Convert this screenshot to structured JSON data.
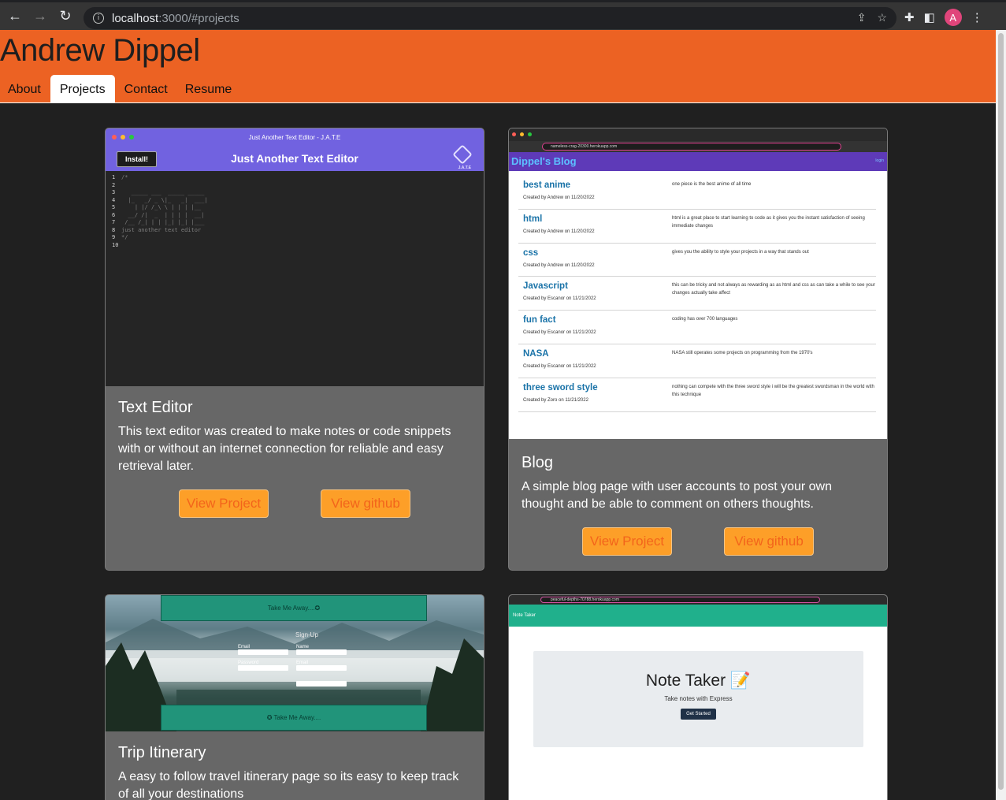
{
  "browser": {
    "url_host": "localhost",
    "url_path": ":3000/#projects",
    "profile_initial": "A"
  },
  "site": {
    "name": "Andrew Dippel",
    "tabs": [
      {
        "label": "About"
      },
      {
        "label": "Projects"
      },
      {
        "label": "Contact"
      },
      {
        "label": "Resume"
      }
    ],
    "active_tab": "Projects"
  },
  "projects": [
    {
      "title": "Text Editor",
      "description": "This text editor was created to make notes or code snippets with or without an internet connection for reliable and easy retrieval later.",
      "view_project": "View Project",
      "view_github": "View github",
      "thumb": {
        "window_title": "Just Another Text Editor - J.A.T.E",
        "app_title": "Just Another Text Editor",
        "install": "Install!",
        "logo_text": "J.A.T.E",
        "gutter": [
          "1",
          "2",
          "3",
          "4",
          "5",
          "6",
          "7",
          "8",
          "9",
          "10"
        ],
        "code": "/*\n\n   _____ ___  _____ _____\n  |_   _/ _ \\|_   _|  ___|\n    | |/ /_\\ \\ | | | |__\n  __/ /|  _  | | | |  __|\n /__ /_| | | |_| |_| |___\njust another text editor\n*/"
      }
    },
    {
      "title": "Blog",
      "description": "A simple blog page with user accounts to post your own thought and be able to comment on others thoughts.",
      "view_project": "View Project",
      "view_github": "View github",
      "thumb": {
        "address": "nameless-crag-20300.herokuapp.com",
        "blog_title": "Dippel's Blog",
        "login": "login",
        "posts": [
          {
            "title": "best anime",
            "meta": "Created by Andrew on 11/20/2022",
            "body": "one piece is the best anime of all time"
          },
          {
            "title": "html",
            "meta": "Created by Andrew on 11/20/2022",
            "body": "html is a great place to start learning to code as it gives you the instant satisfaction of seeing immediate changes"
          },
          {
            "title": "css",
            "meta": "Created by Andrew on 11/20/2022",
            "body": "gives you the ability to style your projects in a way that stands out"
          },
          {
            "title": "Javascript",
            "meta": "Created by Escanor on 11/21/2022",
            "body": "this can be tricky and not always as rewarding as as html and css as can take a while to see your changes actually take affect"
          },
          {
            "title": "fun fact",
            "meta": "Created by Escanor on 11/21/2022",
            "body": "coding has over 700 languages"
          },
          {
            "title": "NASA",
            "meta": "Created by Escanor on 11/21/2022",
            "body": "NASA still operates some projects on programming from the 1970's"
          },
          {
            "title": "three sword style",
            "meta": "Created by Zoro on 11/21/2022",
            "body": "nothing can compete with the three sword style i will be the greatest swordsman in the world with this technique"
          }
        ]
      }
    },
    {
      "title": "Trip Itinerary",
      "description": "A easy to follow travel itinerary page so its easy to keep track of all your destinations",
      "thumb": {
        "top_band": "Take Me Away....✪",
        "bottom_band": "✪ Take Me Away....",
        "form_title": "Sign-Up",
        "labels": [
          "Email",
          "Name",
          "Password",
          "Email"
        ]
      }
    },
    {
      "thumb": {
        "address": "peaceful-depths-70788.herokuapp.com",
        "nav": "Note Taker",
        "heading": "Note Taker 📝",
        "sub": "Take notes with Express",
        "button": "Get Started"
      }
    }
  ],
  "colors": {
    "header": "#ec6223",
    "card": "#676767",
    "button": "#fd9f28",
    "button_text": "#f3641b"
  }
}
